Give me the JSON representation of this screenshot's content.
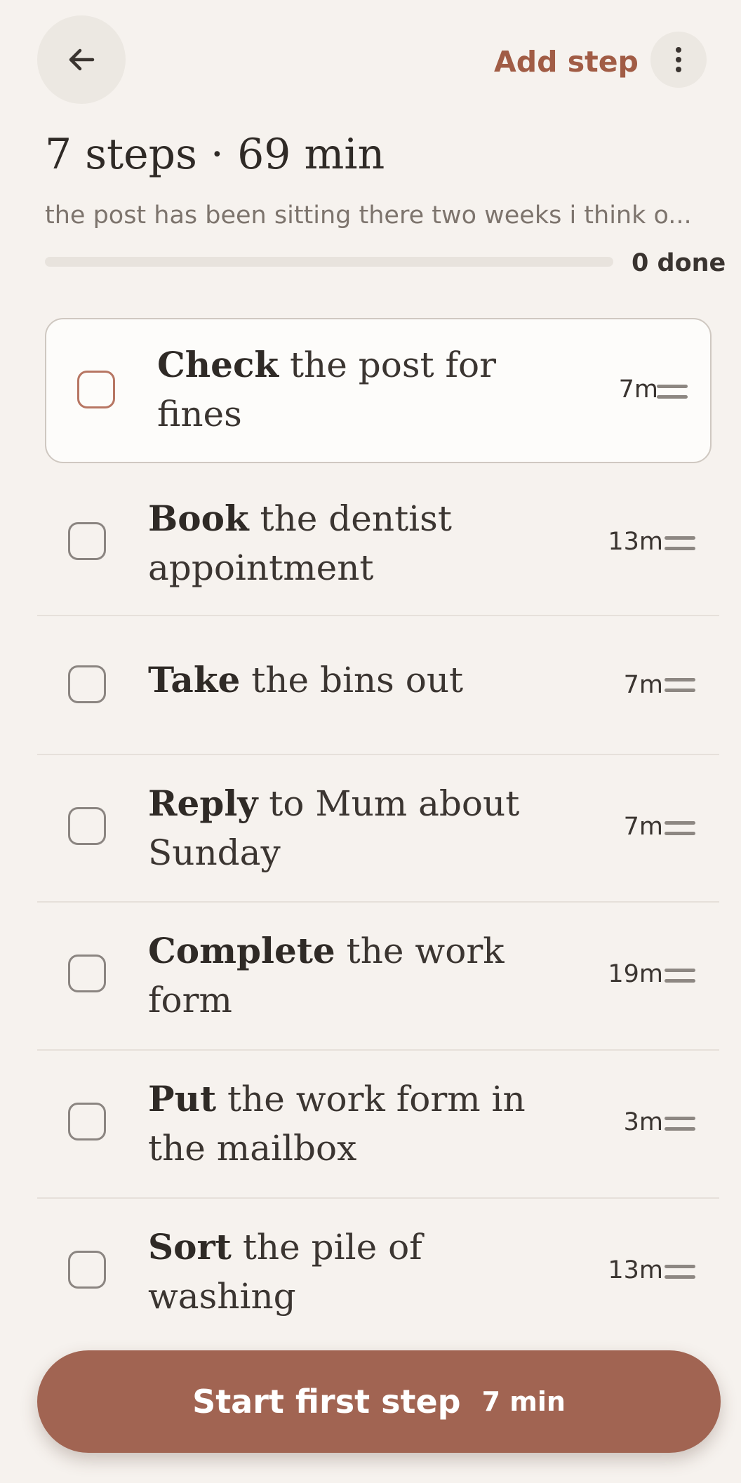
{
  "header": {
    "title": "7 steps · 69 min",
    "summary": "the post has been sitting there two weeks i think o...",
    "progress_fraction": 0,
    "done_label": "0 done",
    "add_step_label": "Add step",
    "back_icon": "arrow-left-icon",
    "more_icon": "more-vertical-icon"
  },
  "steps": [
    {
      "verb": "Check",
      "rest": "the post for fines",
      "duration": "7m"
    },
    {
      "verb": "Book",
      "rest": "the dentist appointment",
      "duration": "13m"
    },
    {
      "verb": "Take",
      "rest": "the bins out",
      "duration": "7m"
    },
    {
      "verb": "Reply",
      "rest": "to Mum about Sunday",
      "duration": "7m"
    },
    {
      "verb": "Complete",
      "rest": "the work form",
      "duration": "19m"
    },
    {
      "verb": "Put",
      "rest": "the work form in the mailbox",
      "duration": "3m"
    },
    {
      "verb": "Sort",
      "rest": "the pile of washing",
      "duration": "13m"
    }
  ],
  "cta": {
    "label": "Start first step",
    "time": "7 min"
  },
  "colors": {
    "accent": "#a15c45",
    "cta_background": "#a16452",
    "background": "#f6f2ee"
  }
}
